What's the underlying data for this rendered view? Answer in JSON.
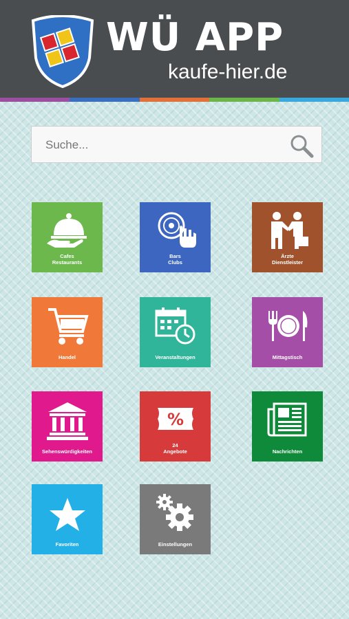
{
  "header": {
    "title": "WÜ APP",
    "subtitle": "kaufe-hier.de",
    "background": "#4a4d50",
    "stripe_colors": [
      "#9c4fa0",
      "#3a6fc0",
      "#e2703a",
      "#6cb54a",
      "#3aa8dc"
    ]
  },
  "search": {
    "placeholder": "Suche..."
  },
  "tiles": [
    {
      "label": "Cafes\nRestaurants",
      "color": "#6cb84c",
      "icon": "cloche-icon"
    },
    {
      "label": "Bars\nClubs",
      "color": "#3c66c0",
      "icon": "dj-turntable-icon"
    },
    {
      "label": "Ärzte\nDienstleister",
      "color": "#a0522d",
      "icon": "handshake-icon"
    },
    {
      "label": "Handel",
      "color": "#f07838",
      "icon": "shopping-cart-icon"
    },
    {
      "label": "Veranstaltungen",
      "color": "#30b49a",
      "icon": "calendar-clock-icon"
    },
    {
      "label": "Mittagstisch",
      "color": "#a44ea8",
      "icon": "plate-cutlery-icon"
    },
    {
      "label": "Sehenswürdigkeiten",
      "color": "#e01a8c",
      "icon": "museum-icon"
    },
    {
      "label": "24\nAngebote",
      "color": "#d73a3a",
      "icon": "percent-ticket-icon"
    },
    {
      "label": "Nachrichten",
      "color": "#0f8a3a",
      "icon": "newspaper-icon"
    },
    {
      "label": "Favoriten",
      "color": "#22b0e6",
      "icon": "star-icon"
    },
    {
      "label": "Einstellungen",
      "color": "#7a7a7a",
      "icon": "gears-icon"
    }
  ]
}
